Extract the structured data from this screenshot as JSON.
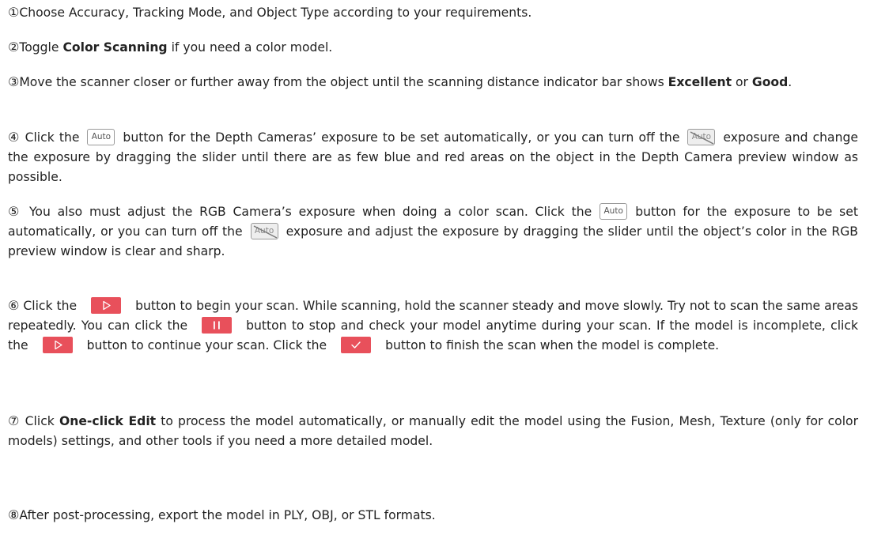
{
  "steps": [
    {
      "num": "①",
      "text": "Choose Accuracy, Tracking Mode, and Object Type according to your requirements."
    },
    {
      "num": "②",
      "pre": "Toggle ",
      "bold": "Color Scanning",
      "post": " if you need a color model."
    },
    {
      "num": "③",
      "pre": "Move the scanner closer or further away from the object until the scanning distance indicator bar shows ",
      "bold1": "Excellent",
      "mid": " or ",
      "bold2": "Good",
      "post": "."
    },
    {
      "num": "④",
      "t1": "Click the",
      "t2": "button for the Depth Cameras’ exposure to be set automatically, or you can turn off the",
      "t3": "exposure and change the exposure by dragging the slider until there are as few blue and red areas on the object in the Depth Camera preview window as possible."
    },
    {
      "num": "⑤",
      "t1": "You also must adjust the RGB Camera’s exposure when doing a color scan. Click the",
      "t2": "button for the exposure to be set automatically, or you can turn off the",
      "t3": "exposure and adjust the exposure by dragging the slider until the object’s color in the RGB preview window is clear and sharp."
    },
    {
      "num": "⑥",
      "t1": "Click the",
      "t2": "button to begin your scan. While scanning, hold the scanner steady and move slowly. Try not to scan the same areas repeatedly. You can click the",
      "t3": "button to stop and check your model anytime during your scan. If the model is incomplete, click the",
      "t4": "button to continue your scan. Click the",
      "t5": "button to finish the scan when the model is complete."
    },
    {
      "num": "⑦",
      "pre": "Click ",
      "bold": "One-click Edit",
      "post": " to process the model automatically, or manually edit the model using the Fusion, Mesh, Texture (only for color models) settings, and other tools if you need a more detailed model."
    },
    {
      "num": "⑧",
      "text": "After post-processing, export the model in PLY, OBJ, or STL formats."
    }
  ],
  "icons": {
    "auto_label": "Auto",
    "auto_off_label": "Auto",
    "accent_color": "#e8505b",
    "play_icon": "play-icon",
    "pause_icon": "pause-icon",
    "check_icon": "check-icon"
  }
}
